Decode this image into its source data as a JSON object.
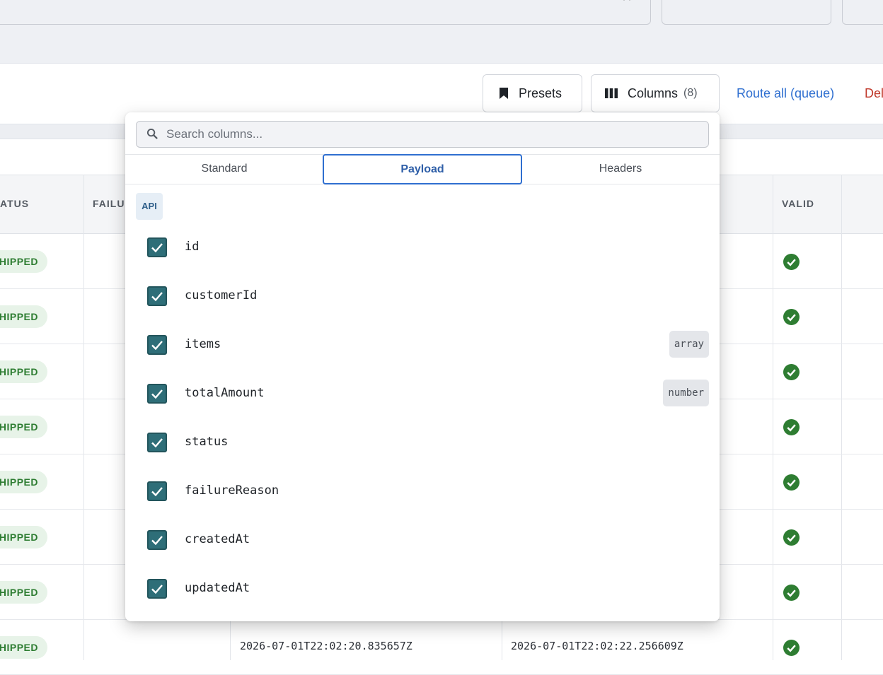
{
  "toolbar": {
    "presets_label": "Presets",
    "columns_label": "Columns",
    "columns_count": "(8)",
    "route_all_label": "Route all (queue)",
    "delete_label": "Del"
  },
  "table": {
    "headers": [
      "ATUS",
      "FAILU",
      "VALID"
    ],
    "rows": [
      {
        "status": "HIPPED"
      },
      {
        "status": "HIPPED"
      },
      {
        "status": "HIPPED"
      },
      {
        "status": "HIPPED"
      },
      {
        "status": "HIPPED"
      },
      {
        "status": "HIPPED"
      },
      {
        "status": "HIPPED"
      },
      {
        "status": "HIPPED",
        "created": "2026-07-01T22:02:20.835657Z",
        "updated": "2026-07-01T22:02:22.256609Z"
      }
    ]
  },
  "popover": {
    "search_placeholder": "Search columns...",
    "tabs": [
      "Standard",
      "Payload",
      "Headers"
    ],
    "active_tab": "Payload",
    "group_label": "API",
    "items": [
      {
        "label": "id",
        "checked": true,
        "type": ""
      },
      {
        "label": "customerId",
        "checked": true,
        "type": ""
      },
      {
        "label": "items",
        "checked": true,
        "type": "array"
      },
      {
        "label": "totalAmount",
        "checked": true,
        "type": "number"
      },
      {
        "label": "status",
        "checked": true,
        "type": ""
      },
      {
        "label": "failureReason",
        "checked": true,
        "type": ""
      },
      {
        "label": "createdAt",
        "checked": true,
        "type": ""
      },
      {
        "label": "updatedAt",
        "checked": true,
        "type": ""
      }
    ]
  },
  "colors": {
    "accent": "#2f6fd0",
    "checkbox": "#2e6e78",
    "success": "#2e7d32",
    "danger": "#c0392b"
  }
}
